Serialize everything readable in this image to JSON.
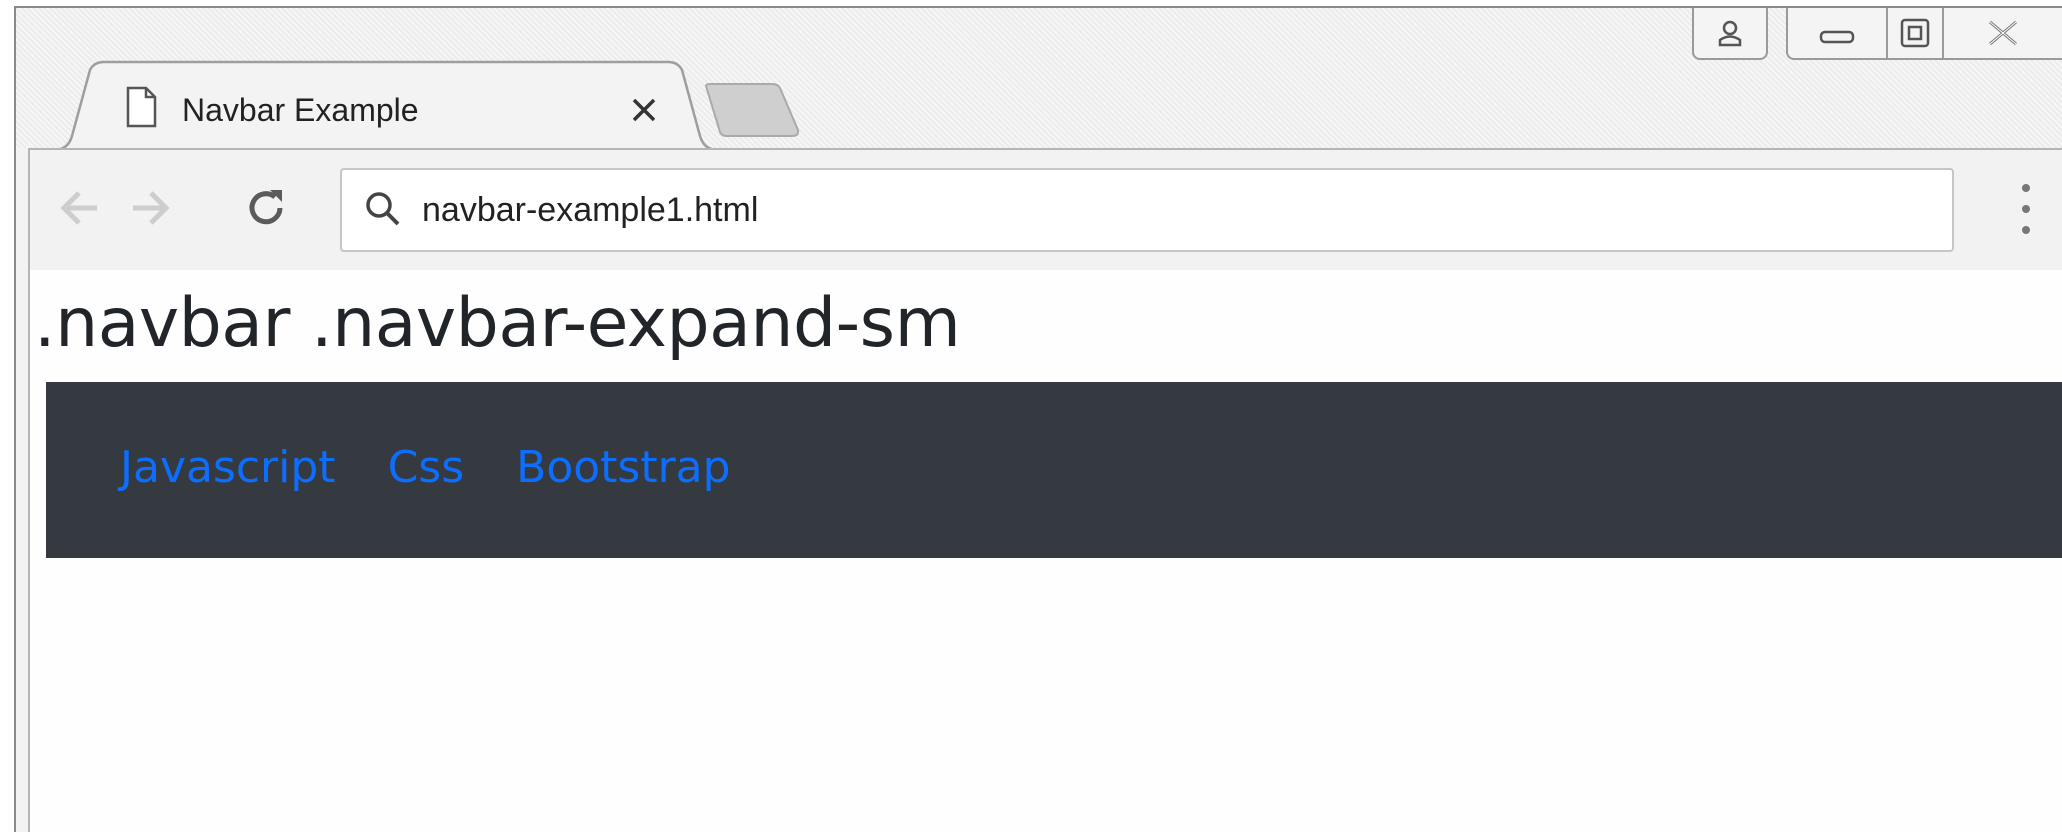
{
  "browser": {
    "tab": {
      "title": "Navbar Example",
      "icon": "page-icon"
    },
    "address_bar": {
      "value": "navbar-example1.html",
      "icon": "search-icon"
    },
    "toolbar_icons": [
      "back-arrow-icon",
      "forward-arrow-icon",
      "reload-icon",
      "menu-dots-icon"
    ],
    "window_controls": [
      "profile-icon",
      "minimize-icon",
      "maximize-icon",
      "close-icon"
    ]
  },
  "page": {
    "heading": ".navbar .navbar-expand-sm",
    "navbar": {
      "background": "#343a40",
      "link_color": "#0d6efd",
      "links": [
        {
          "label": "Javascript"
        },
        {
          "label": "Css"
        },
        {
          "label": "Bootstrap"
        }
      ]
    }
  }
}
